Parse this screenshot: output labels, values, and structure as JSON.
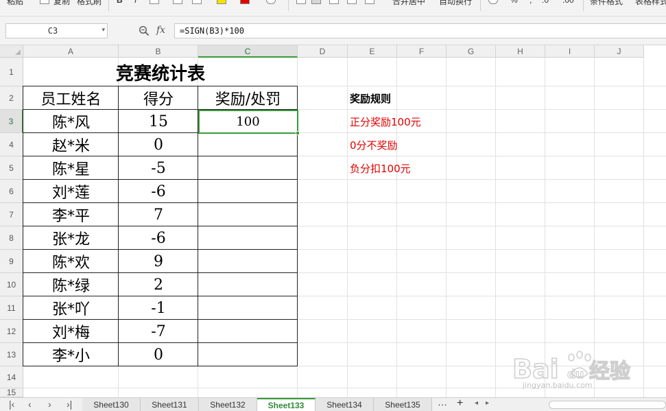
{
  "ribbon": {
    "items": [
      "粘贴",
      "复制",
      "格式刷",
      "合并居中",
      "自动换行",
      "条件格式",
      "表格样式"
    ]
  },
  "formula_bar": {
    "cell_ref": "C3",
    "fx_label": "fx",
    "formula": "=SIGN(B3)*100"
  },
  "columns": [
    "A",
    "B",
    "C",
    "D",
    "E",
    "F",
    "G",
    "H",
    "I",
    "J"
  ],
  "active_column": "C",
  "rows": [
    "1",
    "2",
    "3",
    "4",
    "5",
    "6",
    "7",
    "8",
    "9",
    "10",
    "11",
    "12",
    "13",
    "14",
    "15"
  ],
  "active_row": "3",
  "sheet": {
    "title": "竞赛统计表",
    "headers": {
      "name": "员工姓名",
      "score": "得分",
      "reward": "奖励/处罚"
    },
    "records": [
      {
        "name": "陈*风",
        "score": "15",
        "reward": "100"
      },
      {
        "name": "赵*米",
        "score": "0",
        "reward": ""
      },
      {
        "name": "陈*星",
        "score": "-5",
        "reward": ""
      },
      {
        "name": "刘*莲",
        "score": "-6",
        "reward": ""
      },
      {
        "name": "李*平",
        "score": "7",
        "reward": ""
      },
      {
        "name": "张*龙",
        "score": "-6",
        "reward": ""
      },
      {
        "name": "陈*欢",
        "score": "9",
        "reward": ""
      },
      {
        "name": "陈*绿",
        "score": "2",
        "reward": ""
      },
      {
        "name": "张*吖",
        "score": "-1",
        "reward": ""
      },
      {
        "name": "刘*梅",
        "score": "-7",
        "reward": ""
      },
      {
        "name": "李*小",
        "score": "0",
        "reward": ""
      }
    ]
  },
  "rules": {
    "heading": "奖励规则",
    "lines": [
      "正分奖励100元",
      "0分不奖励",
      "负分扣100元"
    ]
  },
  "tabs": {
    "items": [
      "Sheet130",
      "Sheet131",
      "Sheet132",
      "Sheet133",
      "Sheet134",
      "Sheet135"
    ],
    "active": "Sheet133",
    "more": "···",
    "add": "+"
  },
  "watermark": {
    "brand": "Bai",
    "brand2": "du",
    "cn": "经验",
    "url": "jingyan.baidu.com"
  },
  "colors": {
    "accent": "#3a9a3a",
    "rule_red": "#e00000",
    "grid": "#e1e1e1"
  }
}
